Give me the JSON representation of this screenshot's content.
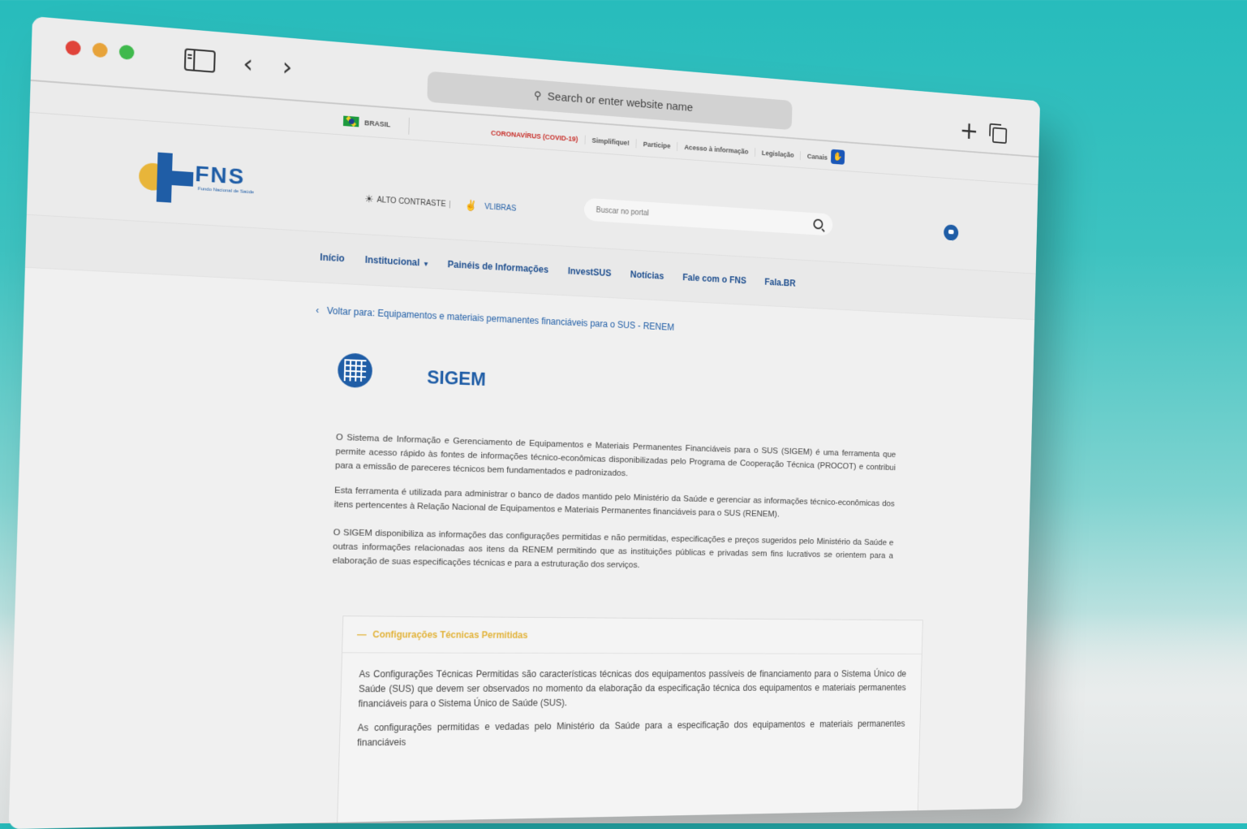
{
  "browser": {
    "url_placeholder": "Search or enter website name",
    "back_glyph": "‹",
    "forward_glyph": "›",
    "new_tab_glyph": "+"
  },
  "gov_bar": {
    "country": "BRASIL",
    "links": [
      "CORONAVÍRUS (COVID-19)",
      "Simplifique!",
      "Participe",
      "Acesso à informação",
      "Legislação",
      "Canais"
    ]
  },
  "header": {
    "logo_text": "FNS",
    "logo_subtitle": "Fundo Nacional de Saúde",
    "contrast_label": "ALTO CONTRASTE",
    "vlibras_label": "VLIBRAS",
    "search_placeholder": "Buscar no portal"
  },
  "nav": {
    "items": [
      "Início",
      "Institucional",
      "Painéis de Informações",
      "InvestSUS",
      "Notícias",
      "Fale com o FNS",
      "Fala.BR"
    ]
  },
  "content": {
    "back_link": "Voltar para: Equipamentos e materiais permanentes financiáveis para o SUS - RENEM",
    "title": "SIGEM",
    "paragraphs": [
      "O Sistema de Informação e Gerenciamento de Equipamentos e Materiais Permanentes Financiáveis para o SUS (SIGEM) é uma ferramenta que permite acesso rápido às fontes de informações técnico-econômicas disponibilizadas pelo Programa de Cooperação Técnica (PROCOT) e contribui para a emissão de pareceres técnicos bem fundamentados e padronizados.",
      "Esta ferramenta é utilizada para administrar o banco de dados mantido pelo Ministério da Saúde e gerenciar as informações técnico-econômicas dos itens pertencentes à Relação Nacional de Equipamentos e Materiais Permanentes financiáveis para o SUS (RENEM).",
      "O SIGEM disponibiliza as informações das configurações permitidas e não permitidas, especificações e preços sugeridos pelo Ministério da Saúde e outras informações relacionadas aos itens da RENEM permitindo que as instituições públicas e privadas sem fins lucrativos se orientem para a elaboração de suas especificações técnicas e para a estruturação dos serviços."
    ],
    "accordion": {
      "title": "Configurações Técnicas Permitidas",
      "body": [
        "As Configurações Técnicas Permitidas são características técnicas dos equipamentos passíveis de financiamento para o Sistema Único de Saúde (SUS) que devem ser observados no momento da elaboração da especificação técnica dos equipamentos e materiais permanentes financiáveis para o Sistema Único de Saúde (SUS).",
        "As configurações permitidas e vedadas pelo Ministério da Saúde para a especificação dos equipamentos e materiais permanentes financiáveis"
      ]
    }
  }
}
